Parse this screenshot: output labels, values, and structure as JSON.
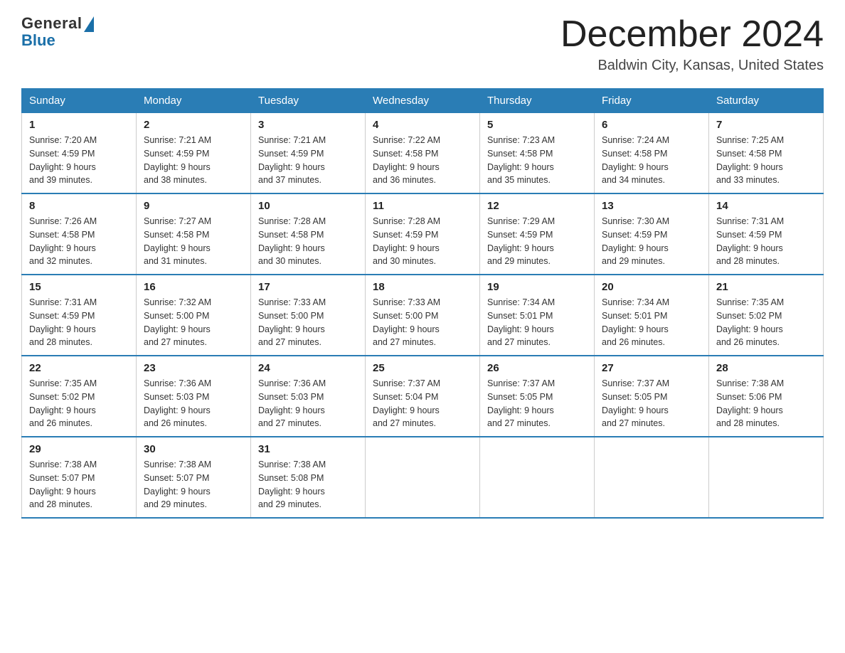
{
  "logo": {
    "general": "General",
    "blue": "Blue"
  },
  "header": {
    "month_year": "December 2024",
    "location": "Baldwin City, Kansas, United States"
  },
  "days_of_week": [
    "Sunday",
    "Monday",
    "Tuesday",
    "Wednesday",
    "Thursday",
    "Friday",
    "Saturday"
  ],
  "weeks": [
    [
      {
        "day": "1",
        "sunrise": "7:20 AM",
        "sunset": "4:59 PM",
        "daylight": "9 hours and 39 minutes."
      },
      {
        "day": "2",
        "sunrise": "7:21 AM",
        "sunset": "4:59 PM",
        "daylight": "9 hours and 38 minutes."
      },
      {
        "day": "3",
        "sunrise": "7:21 AM",
        "sunset": "4:59 PM",
        "daylight": "9 hours and 37 minutes."
      },
      {
        "day": "4",
        "sunrise": "7:22 AM",
        "sunset": "4:58 PM",
        "daylight": "9 hours and 36 minutes."
      },
      {
        "day": "5",
        "sunrise": "7:23 AM",
        "sunset": "4:58 PM",
        "daylight": "9 hours and 35 minutes."
      },
      {
        "day": "6",
        "sunrise": "7:24 AM",
        "sunset": "4:58 PM",
        "daylight": "9 hours and 34 minutes."
      },
      {
        "day": "7",
        "sunrise": "7:25 AM",
        "sunset": "4:58 PM",
        "daylight": "9 hours and 33 minutes."
      }
    ],
    [
      {
        "day": "8",
        "sunrise": "7:26 AM",
        "sunset": "4:58 PM",
        "daylight": "9 hours and 32 minutes."
      },
      {
        "day": "9",
        "sunrise": "7:27 AM",
        "sunset": "4:58 PM",
        "daylight": "9 hours and 31 minutes."
      },
      {
        "day": "10",
        "sunrise": "7:28 AM",
        "sunset": "4:58 PM",
        "daylight": "9 hours and 30 minutes."
      },
      {
        "day": "11",
        "sunrise": "7:28 AM",
        "sunset": "4:59 PM",
        "daylight": "9 hours and 30 minutes."
      },
      {
        "day": "12",
        "sunrise": "7:29 AM",
        "sunset": "4:59 PM",
        "daylight": "9 hours and 29 minutes."
      },
      {
        "day": "13",
        "sunrise": "7:30 AM",
        "sunset": "4:59 PM",
        "daylight": "9 hours and 29 minutes."
      },
      {
        "day": "14",
        "sunrise": "7:31 AM",
        "sunset": "4:59 PM",
        "daylight": "9 hours and 28 minutes."
      }
    ],
    [
      {
        "day": "15",
        "sunrise": "7:31 AM",
        "sunset": "4:59 PM",
        "daylight": "9 hours and 28 minutes."
      },
      {
        "day": "16",
        "sunrise": "7:32 AM",
        "sunset": "5:00 PM",
        "daylight": "9 hours and 27 minutes."
      },
      {
        "day": "17",
        "sunrise": "7:33 AM",
        "sunset": "5:00 PM",
        "daylight": "9 hours and 27 minutes."
      },
      {
        "day": "18",
        "sunrise": "7:33 AM",
        "sunset": "5:00 PM",
        "daylight": "9 hours and 27 minutes."
      },
      {
        "day": "19",
        "sunrise": "7:34 AM",
        "sunset": "5:01 PM",
        "daylight": "9 hours and 27 minutes."
      },
      {
        "day": "20",
        "sunrise": "7:34 AM",
        "sunset": "5:01 PM",
        "daylight": "9 hours and 26 minutes."
      },
      {
        "day": "21",
        "sunrise": "7:35 AM",
        "sunset": "5:02 PM",
        "daylight": "9 hours and 26 minutes."
      }
    ],
    [
      {
        "day": "22",
        "sunrise": "7:35 AM",
        "sunset": "5:02 PM",
        "daylight": "9 hours and 26 minutes."
      },
      {
        "day": "23",
        "sunrise": "7:36 AM",
        "sunset": "5:03 PM",
        "daylight": "9 hours and 26 minutes."
      },
      {
        "day": "24",
        "sunrise": "7:36 AM",
        "sunset": "5:03 PM",
        "daylight": "9 hours and 27 minutes."
      },
      {
        "day": "25",
        "sunrise": "7:37 AM",
        "sunset": "5:04 PM",
        "daylight": "9 hours and 27 minutes."
      },
      {
        "day": "26",
        "sunrise": "7:37 AM",
        "sunset": "5:05 PM",
        "daylight": "9 hours and 27 minutes."
      },
      {
        "day": "27",
        "sunrise": "7:37 AM",
        "sunset": "5:05 PM",
        "daylight": "9 hours and 27 minutes."
      },
      {
        "day": "28",
        "sunrise": "7:38 AM",
        "sunset": "5:06 PM",
        "daylight": "9 hours and 28 minutes."
      }
    ],
    [
      {
        "day": "29",
        "sunrise": "7:38 AM",
        "sunset": "5:07 PM",
        "daylight": "9 hours and 28 minutes."
      },
      {
        "day": "30",
        "sunrise": "7:38 AM",
        "sunset": "5:07 PM",
        "daylight": "9 hours and 29 minutes."
      },
      {
        "day": "31",
        "sunrise": "7:38 AM",
        "sunset": "5:08 PM",
        "daylight": "9 hours and 29 minutes."
      },
      null,
      null,
      null,
      null
    ]
  ],
  "labels": {
    "sunrise": "Sunrise:",
    "sunset": "Sunset:",
    "daylight": "Daylight:"
  }
}
